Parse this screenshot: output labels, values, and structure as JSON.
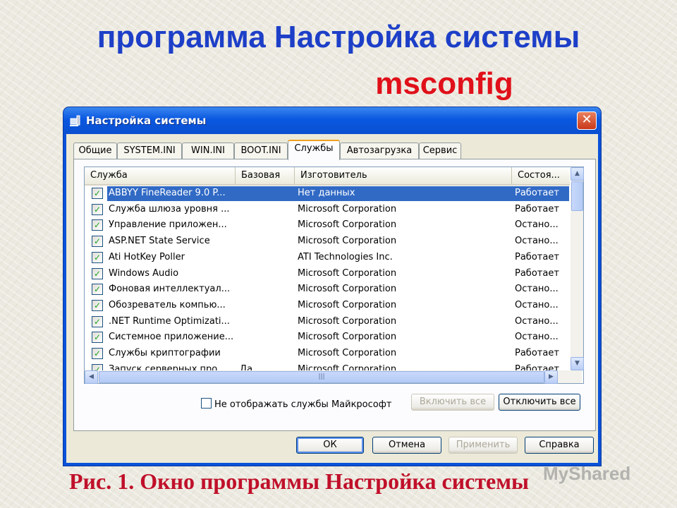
{
  "slide": {
    "title_line1": "программа Настройка системы",
    "title_line2": "msconfig",
    "caption": "Рис. 1.  Окно программы Настройка системы",
    "watermark": "MyShared"
  },
  "window": {
    "title": "Настройка системы",
    "close_glyph": "✕"
  },
  "tabs": [
    {
      "label": "Общие"
    },
    {
      "label": "SYSTEM.INI"
    },
    {
      "label": "WIN.INI"
    },
    {
      "label": "BOOT.INI"
    },
    {
      "label": "Службы"
    },
    {
      "label": "Автозагрузка"
    },
    {
      "label": "Сервис"
    }
  ],
  "active_tab": "Службы",
  "list": {
    "columns": [
      "Служба",
      "Базовая",
      "Изготовитель",
      "Состоя..."
    ],
    "rows": [
      {
        "name": "ABBYY FineReader 9.0 P...",
        "base": "",
        "vendor": "Нет данных",
        "status": "Работает",
        "checked": true,
        "selected": true
      },
      {
        "name": "Служба шлюза уровня ...",
        "base": "",
        "vendor": "Microsoft Corporation",
        "status": "Работает",
        "checked": true
      },
      {
        "name": "Управление приложен...",
        "base": "",
        "vendor": "Microsoft Corporation",
        "status": "Остано...",
        "checked": true
      },
      {
        "name": "ASP.NET State Service",
        "base": "",
        "vendor": "Microsoft Corporation",
        "status": "Остано...",
        "checked": true
      },
      {
        "name": "Ati HotKey Poller",
        "base": "",
        "vendor": "ATI Technologies Inc.",
        "status": "Работает",
        "checked": true
      },
      {
        "name": "Windows Audio",
        "base": "",
        "vendor": "Microsoft Corporation",
        "status": "Работает",
        "checked": true
      },
      {
        "name": "Фоновая интеллектуал...",
        "base": "",
        "vendor": "Microsoft Corporation",
        "status": "Остано...",
        "checked": true
      },
      {
        "name": "Обозреватель компью...",
        "base": "",
        "vendor": "Microsoft Corporation",
        "status": "Остано...",
        "checked": true
      },
      {
        "name": ".NET Runtime Optimizati...",
        "base": "",
        "vendor": "Microsoft Corporation",
        "status": "Остано...",
        "checked": true
      },
      {
        "name": "Системное приложение...",
        "base": "",
        "vendor": "Microsoft Corporation",
        "status": "Остано...",
        "checked": true
      },
      {
        "name": "Службы криптографии",
        "base": "",
        "vendor": "Microsoft Corporation",
        "status": "Работает",
        "checked": true
      },
      {
        "name": "Запуск серверных про...",
        "base": "Да",
        "vendor": "Microsoft Corporation",
        "status": "Работает",
        "checked": true
      }
    ]
  },
  "panel": {
    "hide_ms_label": "Не отображать службы Майкрософт",
    "hide_ms_checked": false,
    "enable_all": "Включить все",
    "disable_all": "Отключить все"
  },
  "buttons": {
    "ok": "ОК",
    "cancel": "Отмена",
    "apply": "Применить",
    "help": "Справка"
  },
  "glyphs": {
    "check": "✓",
    "arrow_up": "▲",
    "arrow_down": "▼",
    "arrow_left": "◀",
    "arrow_right": "▶",
    "grip": "|||"
  }
}
